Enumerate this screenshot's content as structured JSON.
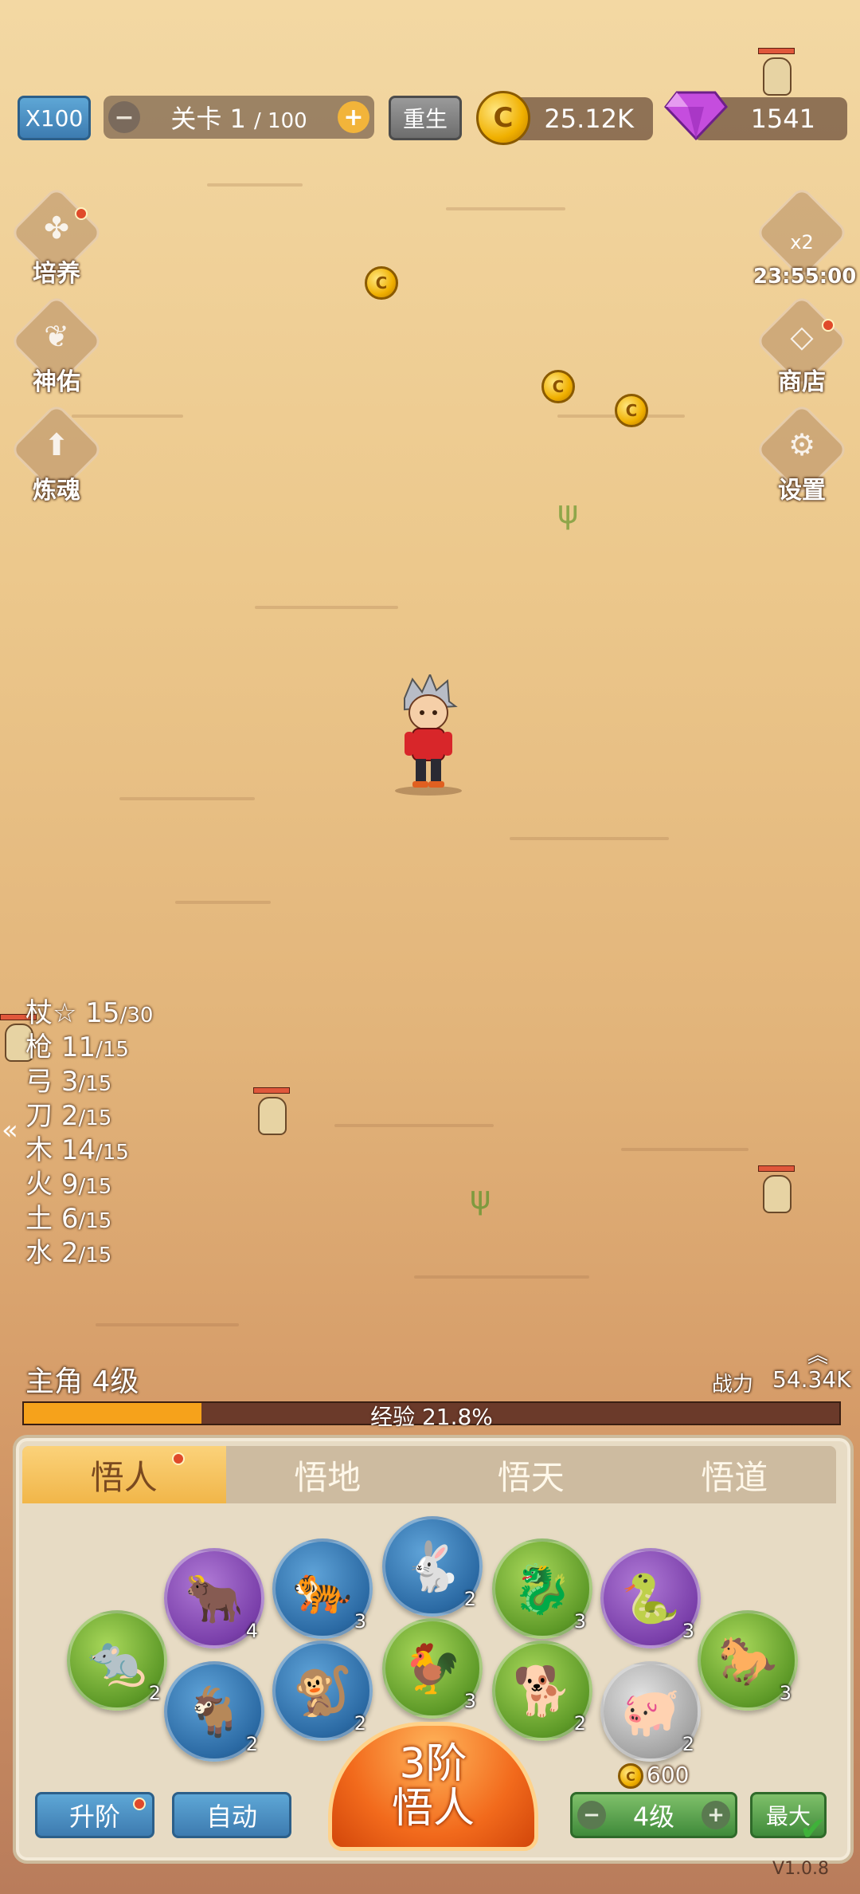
{
  "top_bar": {
    "speed_label": "X100",
    "level_label": "关卡",
    "level_current": "1",
    "level_total": "/ 100",
    "rebirth_label": "重生",
    "gold_value": "25.12K",
    "gem_value": "1541",
    "coin_glyph": "C"
  },
  "left_menu": [
    {
      "label": "培养",
      "icon": "clover-icon"
    },
    {
      "label": "神佑",
      "icon": "wings-icon"
    },
    {
      "label": "炼魂",
      "icon": "upgrade-arrow-icon"
    }
  ],
  "right_menu": {
    "boost_label": "x2",
    "boost_timer": "23:55:00",
    "shop_label": "商店",
    "settings_label": "设置"
  },
  "stats": [
    {
      "name": "杖☆",
      "value": "15",
      "max": "/30"
    },
    {
      "name": "枪",
      "value": "11",
      "max": "/15"
    },
    {
      "name": "弓",
      "value": "3",
      "max": "/15"
    },
    {
      "name": "刀",
      "value": "2",
      "max": "/15"
    },
    {
      "name": "木",
      "value": "14",
      "max": "/15"
    },
    {
      "name": "火",
      "value": "9",
      "max": "/15"
    },
    {
      "name": "土",
      "value": "6",
      "max": "/15"
    },
    {
      "name": "水",
      "value": "2",
      "max": "/15"
    }
  ],
  "collapse_arrow": "«",
  "hero": {
    "level_text": "主角 4级",
    "power_label": "战力",
    "power_value": "54.34K",
    "exp_text": "经验 21.8%",
    "exp_fraction": 0.218,
    "expand_glyph": "︽"
  },
  "tabs": [
    "悟人",
    "悟地",
    "悟天",
    "悟道"
  ],
  "zodiac": [
    {
      "name": "rat",
      "glyph": "🐀",
      "level": "2",
      "color": "green"
    },
    {
      "name": "ox",
      "glyph": "🐂",
      "level": "4",
      "color": "purple"
    },
    {
      "name": "goat",
      "glyph": "🐐",
      "level": "2",
      "color": "blue"
    },
    {
      "name": "tiger",
      "glyph": "🐅",
      "level": "3",
      "color": "blue"
    },
    {
      "name": "monkey",
      "glyph": "🐒",
      "level": "2",
      "color": "blue"
    },
    {
      "name": "rabbit",
      "glyph": "🐇",
      "level": "2",
      "color": "blue"
    },
    {
      "name": "rooster",
      "glyph": "🐓",
      "level": "3",
      "color": "green"
    },
    {
      "name": "dragon",
      "glyph": "🐉",
      "level": "3",
      "color": "green"
    },
    {
      "name": "dog",
      "glyph": "🐕",
      "level": "2",
      "color": "green"
    },
    {
      "name": "snake",
      "glyph": "🐍",
      "level": "3",
      "color": "purple"
    },
    {
      "name": "pig",
      "glyph": "🐖",
      "level": "2",
      "color": "gray"
    },
    {
      "name": "horse",
      "glyph": "🐎",
      "level": "3",
      "color": "green"
    }
  ],
  "actions": {
    "ascend_label": "升阶",
    "auto_label": "自动",
    "stage_line1": "3阶",
    "stage_line2": "悟人",
    "cost_value": "600",
    "level_select": "4级",
    "minus": "−",
    "plus": "+",
    "max_label": "最大"
  },
  "version": "V1.0.8",
  "colors": {
    "exp_fill": "#f6a21b",
    "accent_orange": "#f26a1c",
    "gem": "#c54dde"
  }
}
